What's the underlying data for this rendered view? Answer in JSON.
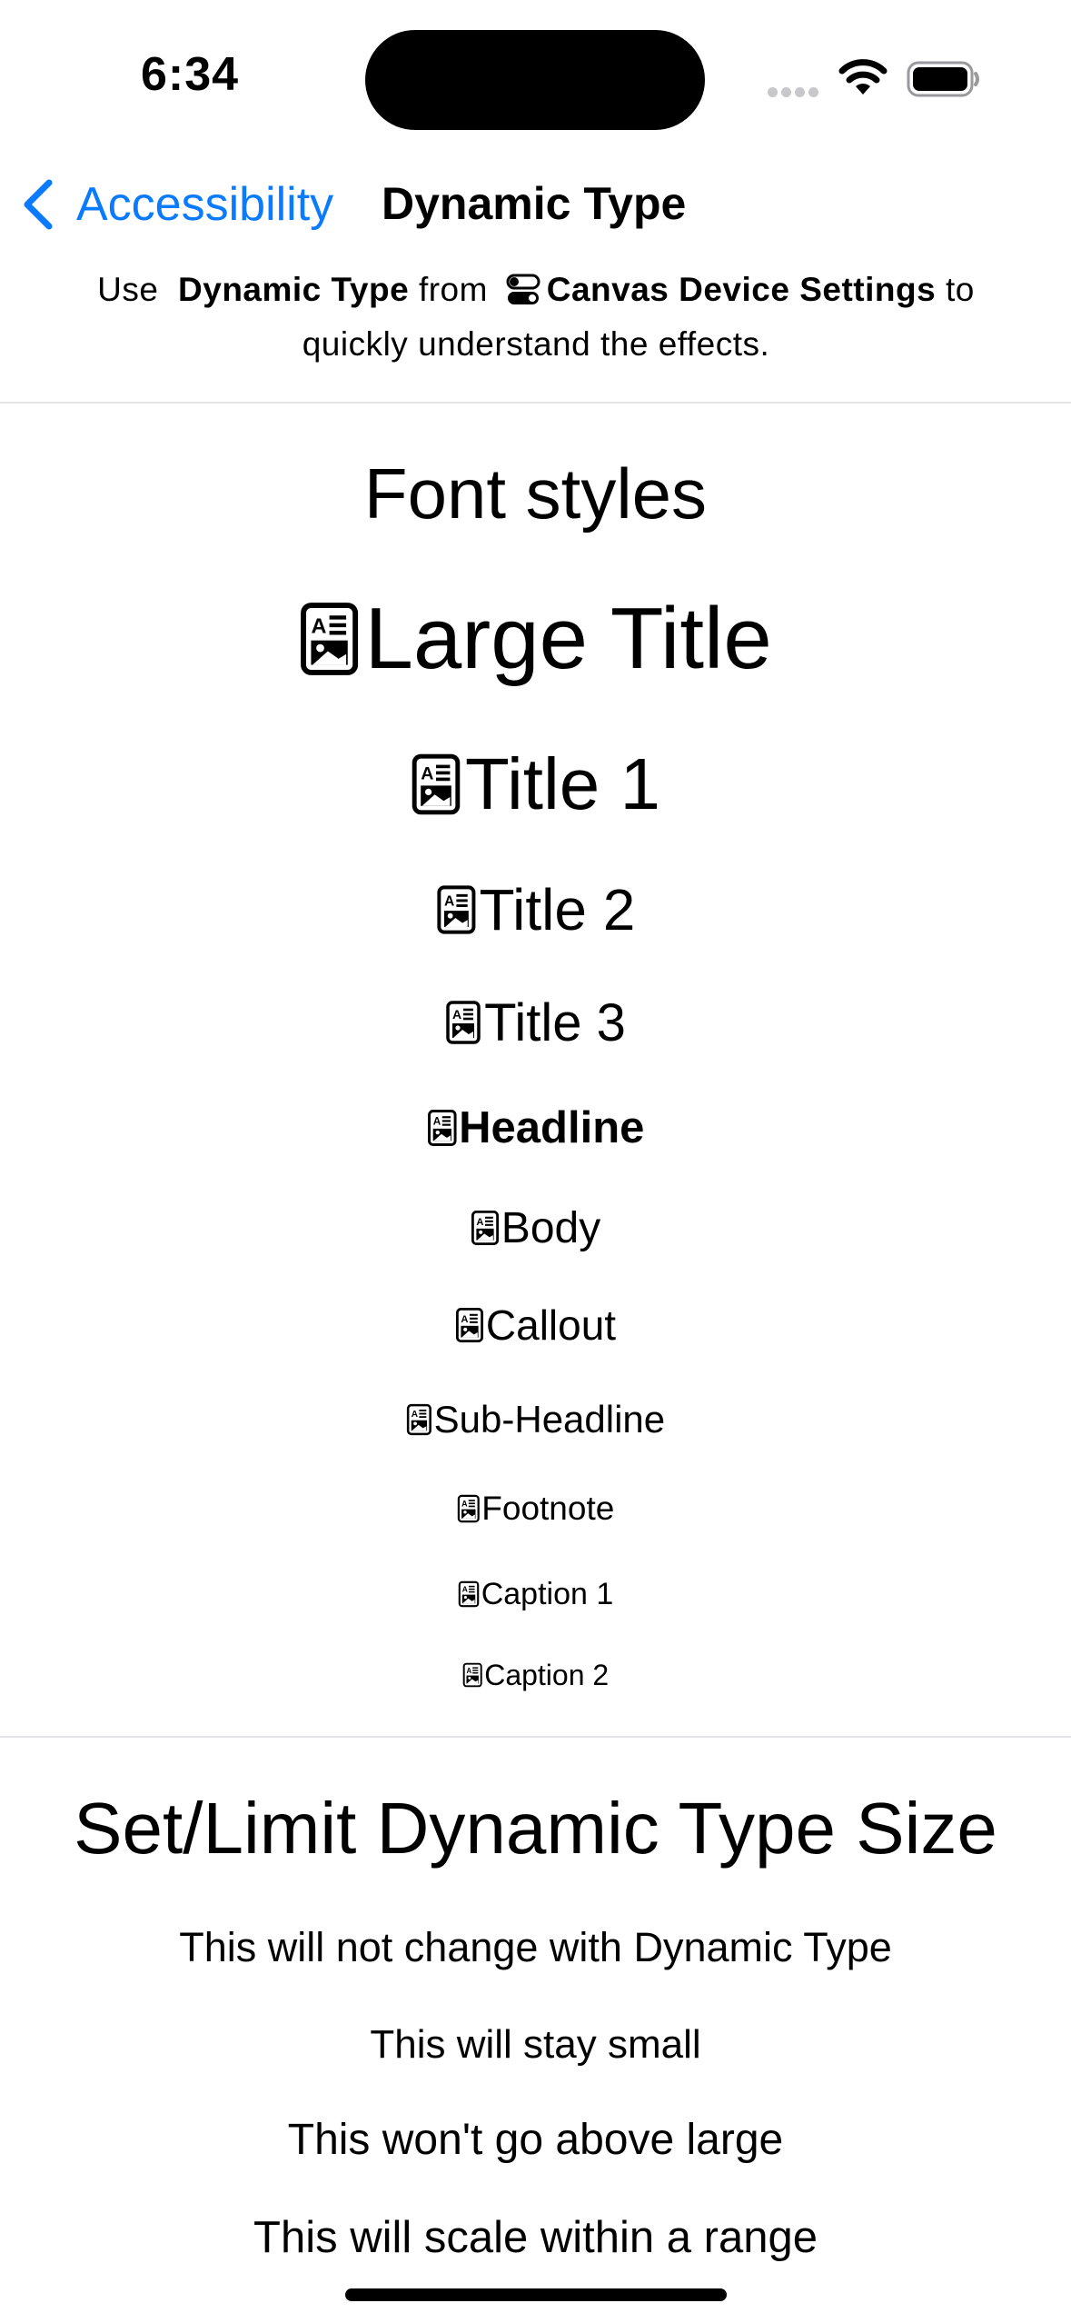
{
  "status_bar": {
    "time": "6:34"
  },
  "nav": {
    "back_label": "Accessibility",
    "title": "Dynamic Type"
  },
  "instructions": {
    "use": "Use",
    "dynamic_type": "Dynamic Type",
    "from": "from",
    "canvas_settings": "Canvas Device Settings",
    "to": "to",
    "line2": "quickly understand the effects."
  },
  "font_styles": {
    "heading": "Font styles",
    "items": [
      {
        "label": "Large Title",
        "icon": "doc-richtext-icon"
      },
      {
        "label": "Title 1",
        "icon": "doc-richtext-icon"
      },
      {
        "label": "Title 2",
        "icon": "doc-richtext-icon"
      },
      {
        "label": "Title 3",
        "icon": "doc-richtext-icon"
      },
      {
        "label": "Headline",
        "icon": "doc-richtext-icon"
      },
      {
        "label": "Body",
        "icon": "doc-richtext-icon"
      },
      {
        "label": "Callout",
        "icon": "doc-richtext-icon"
      },
      {
        "label": "Sub-Headline",
        "icon": "doc-richtext-icon"
      },
      {
        "label": "Footnote",
        "icon": "doc-richtext-icon"
      },
      {
        "label": "Caption 1",
        "icon": "doc-richtext-icon"
      },
      {
        "label": "Caption 2",
        "icon": "doc-richtext-icon"
      }
    ]
  },
  "limit_section": {
    "heading": "Set/Limit Dynamic Type Size",
    "lines": [
      "This will not change with Dynamic Type",
      "This will stay small",
      "This won't go above large",
      "This will scale within a range"
    ]
  },
  "colors": {
    "accent": "#0a7aff",
    "divider": "#e3e3e6"
  }
}
